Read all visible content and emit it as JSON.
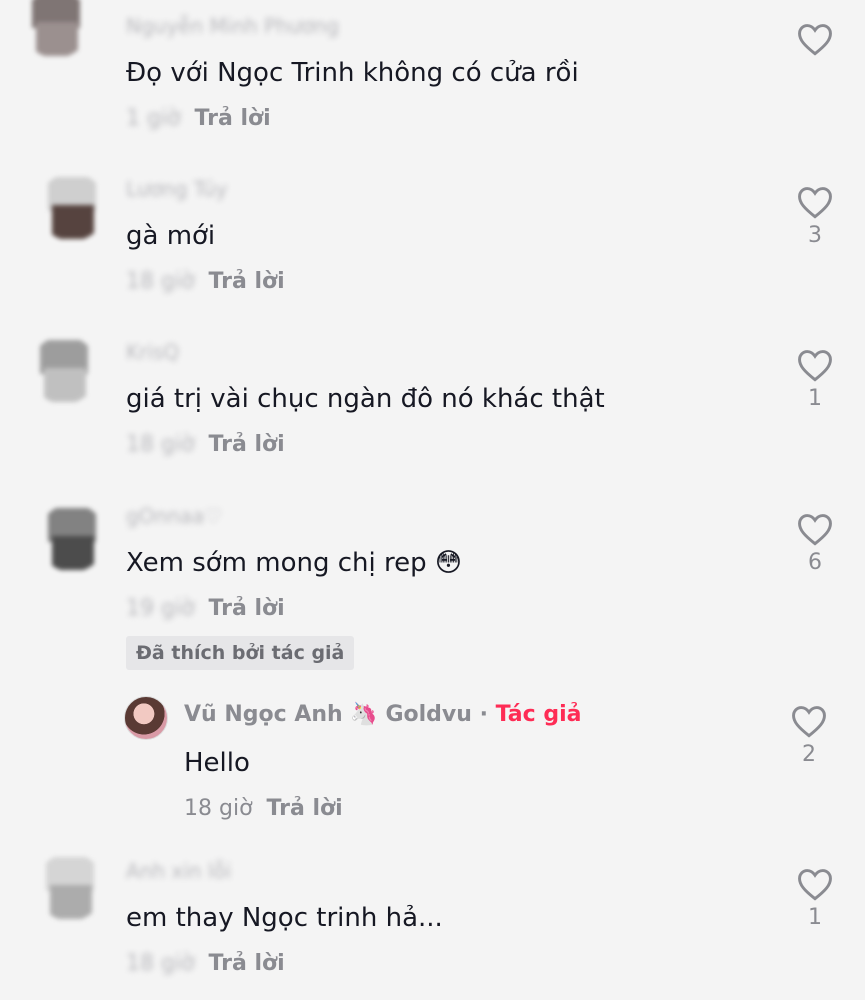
{
  "comments": [
    {
      "username": "Nguyễn Minh Phương",
      "text": "Đọ với Ngọc Trinh không có cửa rồi",
      "time": "1 giờ",
      "reply": "Trả lời",
      "likes": "",
      "avatar_colors": [
        "#6b5f5e",
        "#8c7f7e"
      ]
    },
    {
      "username": "Lương Túy",
      "text": "gà mới",
      "time": "18 giờ",
      "reply": "Trả lời",
      "likes": "3",
      "avatar_colors": [
        "#c9c9c9",
        "#3b2520"
      ]
    },
    {
      "username": "KrisQ",
      "text": "giá trị vài chục ngàn đô nó khác thật",
      "time": "18 giờ",
      "reply": "Trả lời",
      "likes": "1",
      "avatar_colors": [
        "#8f8f8f",
        "#b8b8b8"
      ]
    },
    {
      "username": "gOnnaa♡",
      "text": "Xem sớm mong chị rep 😳",
      "time": "19 giờ",
      "reply": "Trả lời",
      "likes": "6",
      "avatar_colors": [
        "#6f6f6f",
        "#2f2f2f"
      ],
      "badge": "Đã thích bởi tác giả"
    },
    {
      "username": "Anh xin lỗi",
      "text": "em thay Ngọc trinh hả...",
      "time": "18 giờ",
      "reply": "Trả lời",
      "likes": "1",
      "avatar_colors": [
        "#d0d0d0",
        "#a0a0a0"
      ]
    }
  ],
  "author_reply": {
    "name": "Vũ Ngọc Anh",
    "unicorn": "🦄",
    "handle": "Goldvu",
    "separator": "·",
    "author_tag": "Tác giả",
    "text": "Hello",
    "time": "18 giờ",
    "reply": "Trả lời",
    "likes": "2"
  },
  "icons": {
    "like": "heart-outline-icon"
  },
  "colors": {
    "author_tag": "#fe2c55",
    "muted": "#8a8b91",
    "text": "#161823"
  }
}
